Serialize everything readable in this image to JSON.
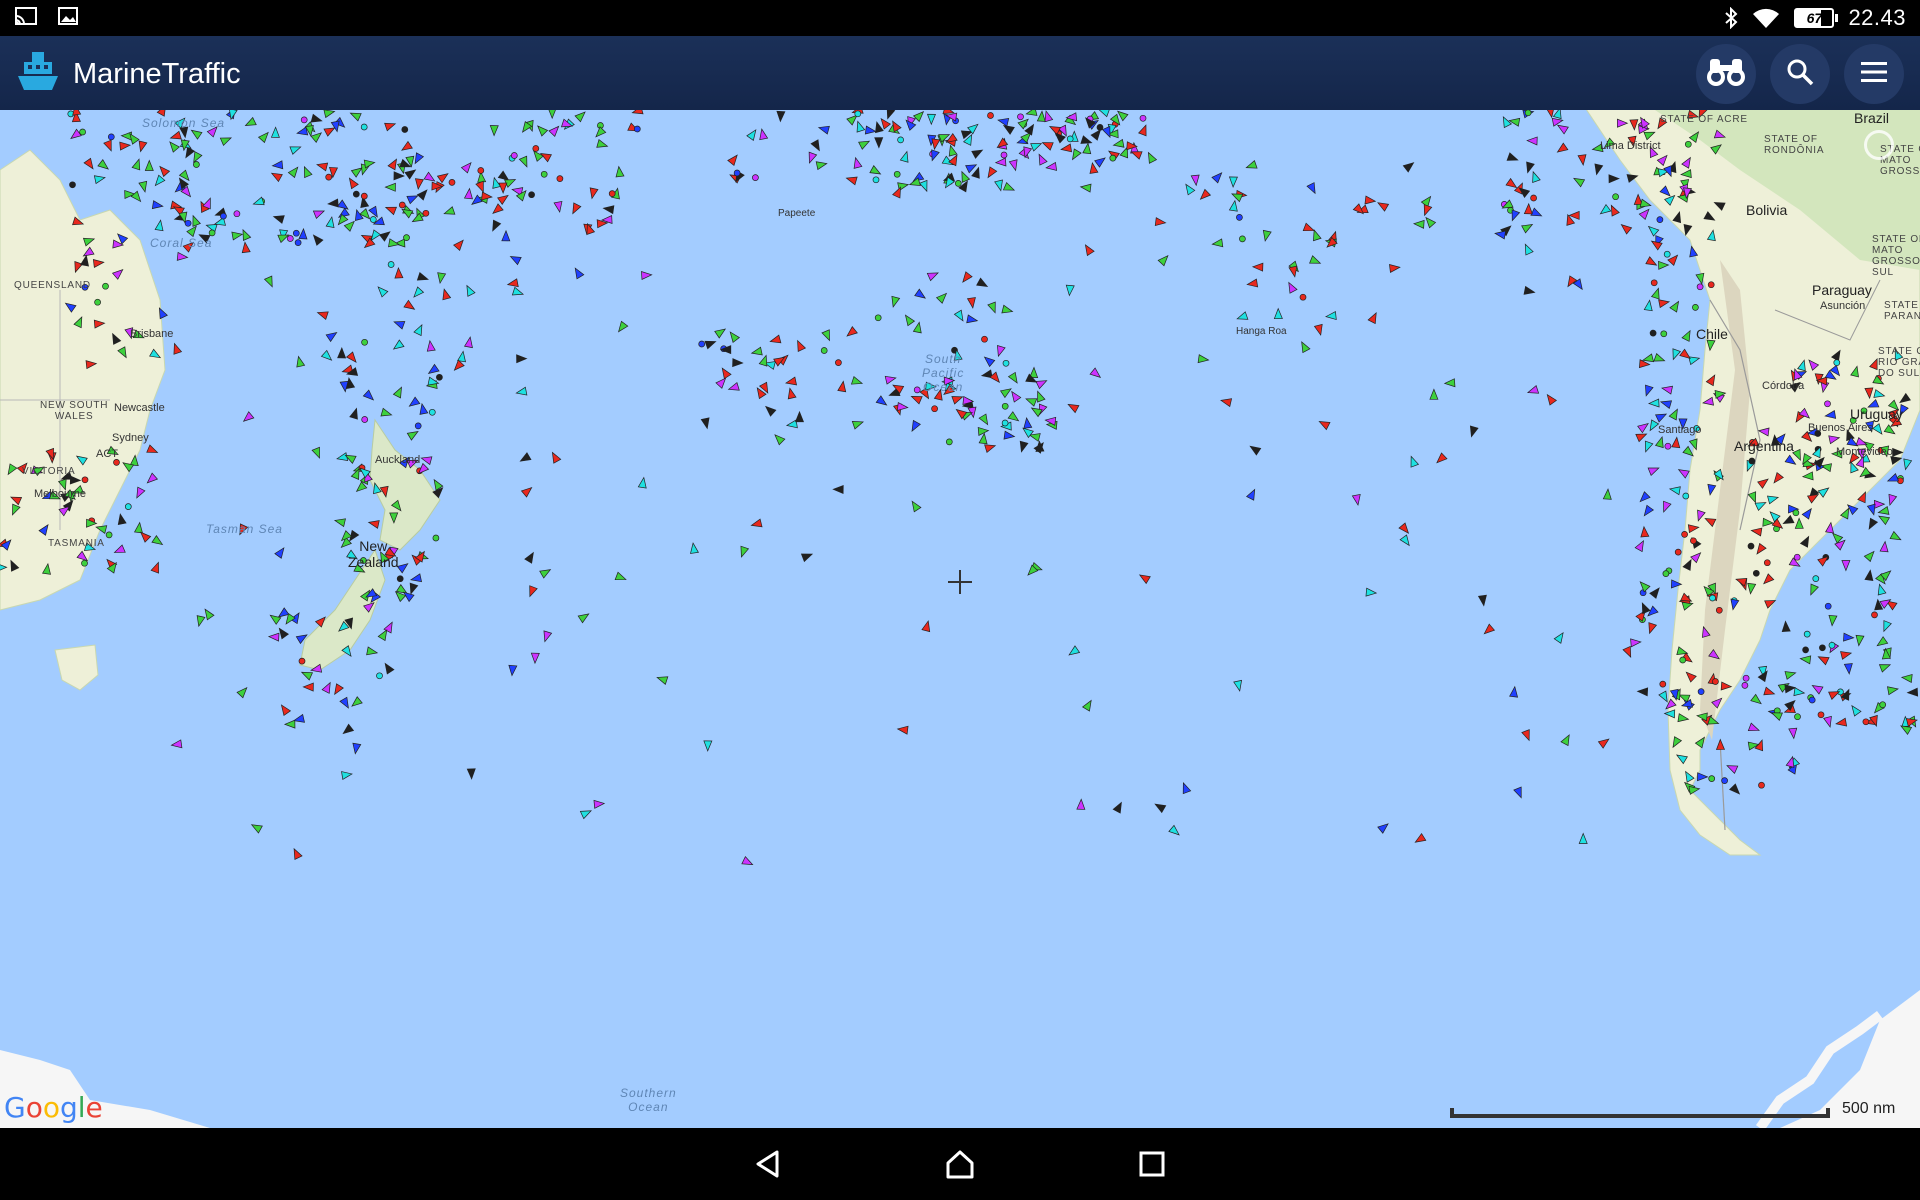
{
  "status_bar": {
    "time": "22.43",
    "battery_level": "67",
    "battery_fraction": 0.67,
    "icons": [
      "cast-icon",
      "image-icon",
      "bluetooth-icon",
      "wifi-icon",
      "battery-icon"
    ]
  },
  "app_bar": {
    "title": "MarineTraffic",
    "logo": "marinetraffic-ship-logo",
    "actions": [
      "binoculars-icon",
      "search-icon",
      "menu-icon"
    ],
    "background": "#1b3058"
  },
  "map": {
    "water_color": "#a3ccff",
    "land_color": "#eef0d8",
    "labels": {
      "queensland": "QUEENSLAND",
      "new_south_wales": "NEW SOUTH\nWALES",
      "victoria": "VICTORIA",
      "tasmania": "TASMANIA",
      "brisbane": "Brisbane",
      "newcastle": "Newcastle",
      "sydney": "Sydney",
      "act": "ACT",
      "melbourne": "Melbourne",
      "coral_sea": "Coral Sea",
      "solomon_sea": "Solomon Sea",
      "tasman_sea": "Tasman Sea",
      "new_zealand": "New\nZealand",
      "auckland": "Auckland",
      "south_pacific_ocean": "South\nPacific\nOcean",
      "southern_ocean": "Southern\nOcean",
      "hanga_roa": "Hanga Roa",
      "papeete": "Papeete",
      "brazil": "Brazil",
      "lima_district": "Lima District",
      "state_of_acre": "STATE OF ACRE",
      "state_of_rondonia": "STATE OF\nRONDÔNIA",
      "state_of_mato_grosso": "STATE OF\nMATO\nGROSSO",
      "state_of_mato_grosso_do_sul": "STATE OF\nMATO\nGROSSO DO\nSUL",
      "bolivia": "Bolivia",
      "paraguay": "Paraguay",
      "asuncion": "Asunción",
      "chile": "Chile",
      "cordoba": "Córdoba",
      "uruguay": "Uruguay",
      "state_of_rio_grande": "STATE OF\nRIO GRANDE\nDO SUL",
      "state_of_parana": "STATE OF\nPARANÁ",
      "santiago": "Santiago",
      "buenos_aires": "Buenos Aires",
      "montevideo": "Montevideo",
      "argentina": "Argentina"
    },
    "google_logo": "Google",
    "scale_label": "500 nm",
    "vessel_colors": {
      "cargo": "#3dd03d",
      "tanker": "#e8281e",
      "passenger": "#2040ff",
      "fishing": "#cc33ff",
      "tug": "#1fe0e0",
      "unknown": "#202020",
      "pleasure": "#ffd700"
    }
  },
  "nav_bar": {
    "buttons": [
      "back-icon",
      "home-icon",
      "recents-icon"
    ]
  }
}
